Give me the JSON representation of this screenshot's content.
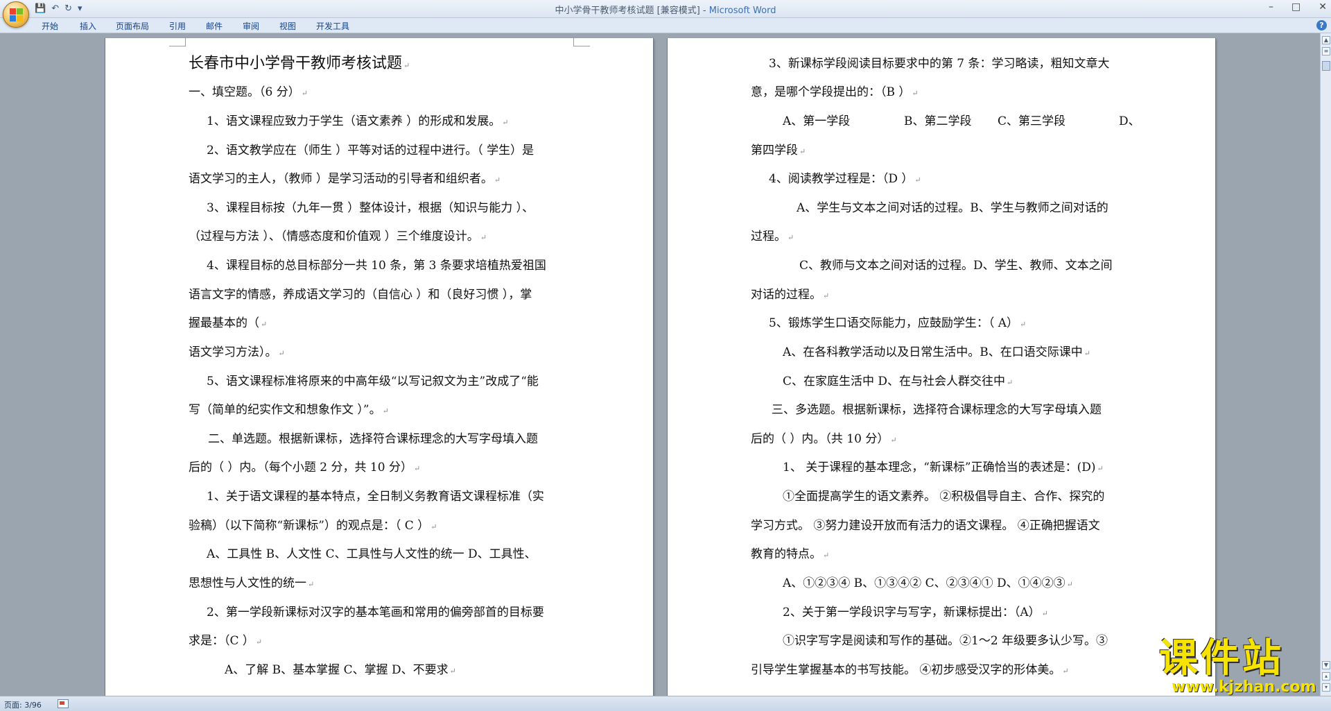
{
  "window": {
    "title": "中小学骨干教师考核试题 [兼容模式] - ",
    "app_name": "Microsoft Word",
    "controls": [
      "–",
      "□",
      "✕"
    ]
  },
  "quick_access": {
    "save": "💾",
    "undo": "↶",
    "redo": "↻",
    "customize": "▾"
  },
  "ribbon_tabs": [
    "开始",
    "插入",
    "页面布局",
    "引用",
    "邮件",
    "审阅",
    "视图",
    "开发工具"
  ],
  "help": "?",
  "left_page": {
    "lines": [
      "长春市中小学骨干教师考核试题",
      "一、填空题。（6 分）",
      "1、语文课程应致力于学生（语文素养 ）的形成和发展。",
      "2、语文教学应在（师生 ）平等对话的过程中进行。（ 学生）是",
      "语文学习的主人，（教师 ）是学习活动的引导者和组织者。",
      "3、课程目标按（九年一贯 ）整体设计，根据（知识与能力 ）、",
      "（过程与方法 ）、（情感态度和价值观 ）三个维度设计。",
      "4、课程目标的总目标部分一共 10 条，第 3 条要求培植热爱祖国",
      "语言文字的情感，养成语文学习的（自信心 ）和（良好习惯 ），掌",
      "握最基本的（",
      "语文学习方法）。",
      "5、语文课程标准将原来的中高年级“以写记叙文为主”改成了“能",
      "写（简单的纪实作文和想象作文 ）”。",
      "二、单选题。根据新课标，选择符合课标理念的大写字母填入题",
      "后的（ ）内。（每个小题 2 分，共 10 分）",
      "1、关于语文课程的基本特点，全日制义务教育语文课程标准（实",
      "验稿）（以下简称“新课标”）的观点是：（ C ）",
      "A、工具性 B、人文性 C、工具性与人文性的统一 D、工具性、",
      "思想性与人文性的统一",
      "2、第一学段新课标对汉字的基本笔画和常用的偏旁部首的目标要",
      "求是：（C ）",
      "A、了解 B、基本掌握 C、掌握 D、不要求"
    ]
  },
  "right_page": {
    "lines": [
      "3、新课标学段阅读目标要求中的第 7 条：学习略读，粗知文章大",
      "意，是哪个学段提出的：（B ）",
      "A、第一学段",
      "B、第二学段",
      "C、第三学段",
      "D、",
      "第四学段",
      "4、阅读教学过程是：（D ）",
      "A、学生与文本之间对话的过程。B、学生与教师之间对话的",
      "过程。",
      "C、教师与文本之间对话的过程。D、学生、教师、文本之间",
      "对话的过程。",
      "5、锻炼学生口语交际能力，应鼓励学生：（ A）",
      "A、在各科教学活动以及日常生活中。B、在口语交际课中",
      "C、在家庭生活中 D、在与社会人群交往中",
      "三、多选题。根据新课标，选择符合课标理念的大写字母填入题",
      "后的（ ）内。（共 10 分）",
      "1、 关于课程的基本理念，“新课标”正确恰当的表述是：(D)",
      "①全面提高学生的语文素养。 ②积极倡导自主、合作、探究的",
      "学习方式。 ③努力建设开放而有活力的语文课程。 ④正确把握语文",
      "教育的特点。",
      "A、①②③④ B、①③④② C、②③④① D、①④②③",
      "2、关于第一学段识字与写字，新课标提出：（A）",
      "①识字写字是阅读和写作的基础。②1～2 年级要多认少写。③",
      "引导学生掌握基本的书写技能。 ④初步感受汉字的形体美。"
    ]
  },
  "paragraph_mark": "↵",
  "status_bar": {
    "page_info": "页面: 3/96"
  },
  "watermark": {
    "text": "课件站",
    "url": "www.kjzhan.com"
  }
}
